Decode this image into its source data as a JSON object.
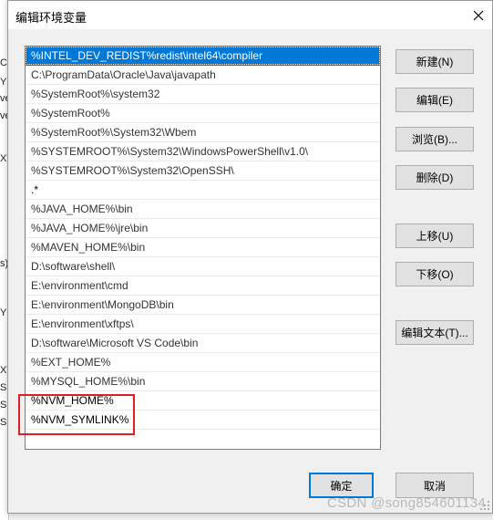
{
  "background_window": {
    "fragments": [
      "C",
      "YI",
      "ve",
      "ve",
      "XT",
      "s)",
      "YI",
      "XT",
      "SS",
      "SS",
      "SS"
    ]
  },
  "dialog": {
    "title": "编辑环境变量",
    "close_icon": "close-icon"
  },
  "path_list": {
    "items": [
      {
        "text": "%INTEL_DEV_REDIST%redist\\intel64\\compiler",
        "selected": true,
        "obscured": false
      },
      {
        "text": "C:\\ProgramData\\Oracle\\Java\\javapath",
        "selected": false,
        "obscured": true
      },
      {
        "text": "%SystemRoot%\\system32",
        "selected": false,
        "obscured": true
      },
      {
        "text": "%SystemRoot%",
        "selected": false,
        "obscured": true
      },
      {
        "text": "%SystemRoot%\\System32\\Wbem",
        "selected": false,
        "obscured": true
      },
      {
        "text": "%SYSTEMROOT%\\System32\\WindowsPowerShell\\v1.0\\",
        "selected": false,
        "obscured": true
      },
      {
        "text": "%SYSTEMROOT%\\System32\\OpenSSH\\",
        "selected": false,
        "obscured": true
      },
      {
        "text": ".*",
        "selected": false,
        "obscured": false
      },
      {
        "text": "%JAVA_HOME%\\bin",
        "selected": false,
        "obscured": true
      },
      {
        "text": "%JAVA_HOME%\\jre\\bin",
        "selected": false,
        "obscured": true
      },
      {
        "text": "%MAVEN_HOME%\\bin",
        "selected": false,
        "obscured": true
      },
      {
        "text": "D:\\software\\shell\\",
        "selected": false,
        "obscured": true
      },
      {
        "text": "E:\\environment\\cmd",
        "selected": false,
        "obscured": true
      },
      {
        "text": "E:\\environment\\MongoDB\\bin",
        "selected": false,
        "obscured": true
      },
      {
        "text": "E:\\environment\\xftps\\",
        "selected": false,
        "obscured": true
      },
      {
        "text": "D:\\software\\Microsoft VS Code\\bin",
        "selected": false,
        "obscured": true
      },
      {
        "text": "%EXT_HOME%",
        "selected": false,
        "obscured": true
      },
      {
        "text": "%MYSQL_HOME%\\bin",
        "selected": false,
        "obscured": true
      },
      {
        "text": "%NVM_HOME%",
        "selected": false,
        "obscured": false
      },
      {
        "text": "%NVM_SYMLINK%",
        "selected": false,
        "obscured": false
      },
      {
        "text": "",
        "selected": false,
        "obscured": false
      }
    ]
  },
  "buttons": {
    "new": "新建(N)",
    "edit": "编辑(E)",
    "browse": "浏览(B)...",
    "delete": "删除(D)",
    "move_up": "上移(U)",
    "move_down": "下移(O)",
    "edit_text": "编辑文本(T)...",
    "ok": "确定",
    "cancel": "取消"
  },
  "watermark": "CSDN @song854601134",
  "colors": {
    "selection": "#0078d7",
    "highlight_box": "#e02020"
  }
}
